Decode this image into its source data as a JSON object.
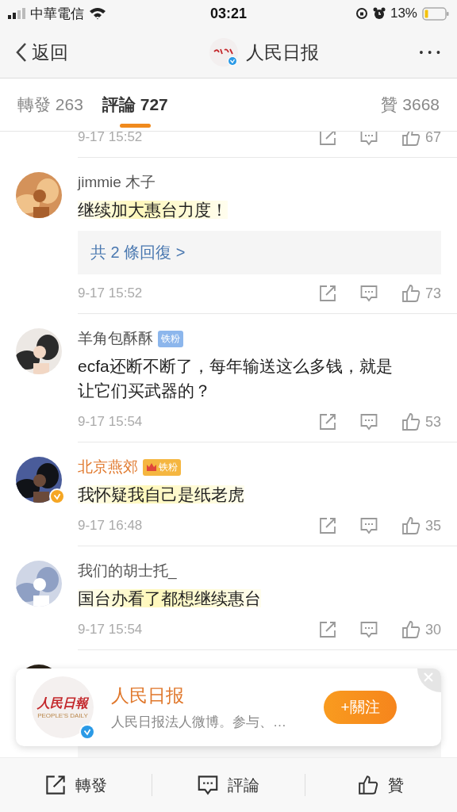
{
  "status_bar": {
    "carrier": "中華電信",
    "time": "03:21",
    "battery": "13%"
  },
  "nav": {
    "back": "返回",
    "title": "人民日报",
    "more": "• • •"
  },
  "tabs": [
    {
      "label": "轉發 263",
      "selected": false
    },
    {
      "label": "評論 727",
      "selected": true
    },
    {
      "label": "贊 3668",
      "selected": false
    }
  ],
  "comments": [
    {
      "kind": "partial",
      "time": "9-17 15:52",
      "likes": "67"
    },
    {
      "kind": "comment",
      "name": "jimmie 木子",
      "vip": false,
      "verified": false,
      "text": "继续加大惠台力度！",
      "highlighted": true,
      "replies": "共 2 條回復 >",
      "time": "9-17 15:52",
      "likes": "73"
    },
    {
      "kind": "comment",
      "name": "羊角包酥酥",
      "vip": false,
      "verified": false,
      "badge": {
        "kind": "fan",
        "label": "铁粉"
      },
      "text": "ecfa还断不断了，每年输送这么多钱，就是让它们买武器的？",
      "highlighted": false,
      "time": "9-17 15:54",
      "likes": "53"
    },
    {
      "kind": "comment",
      "name": "北京燕郊",
      "vip": true,
      "verified": true,
      "badge": {
        "kind": "crown",
        "label": "铁粉"
      },
      "text": "我怀疑我自己是纸老虎",
      "highlighted": true,
      "time": "9-17 16:48",
      "likes": "35"
    },
    {
      "kind": "comment",
      "name": "我们的胡士托_",
      "vip": false,
      "verified": false,
      "text": "国台办看了都想继续惠台",
      "highlighted": true,
      "time": "9-17 15:54",
      "likes": "30"
    },
    {
      "kind": "obscured"
    }
  ],
  "popup": {
    "logo_text": "人民日報",
    "logo_subtext": "PEOPLE'S DAILY",
    "title": "人民日报",
    "subtitle": "人民日报法人微博。参与、…",
    "follow": "+關注"
  },
  "bottom_bar": [
    {
      "label": "轉發",
      "kind": "share"
    },
    {
      "label": "評論",
      "kind": "comment"
    },
    {
      "label": "贊",
      "kind": "like"
    }
  ]
}
